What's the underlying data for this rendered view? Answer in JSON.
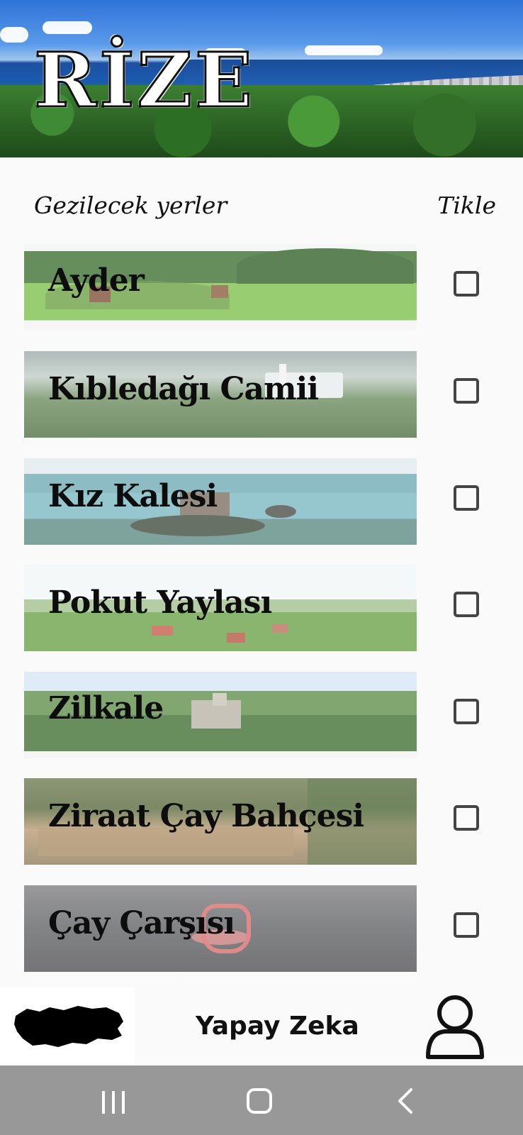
{
  "banner": {
    "logo_text": "RİZE"
  },
  "header": {
    "places_label": "Gezilecek yerler",
    "check_label": "Tikle"
  },
  "places": [
    {
      "name": "Ayder",
      "checked": false
    },
    {
      "name": "Kıbledağı Camii",
      "checked": false
    },
    {
      "name": "Kız Kalesi",
      "checked": false
    },
    {
      "name": "Pokut Yaylası",
      "checked": false
    },
    {
      "name": "Zilkale",
      "checked": false
    },
    {
      "name": "Ziraat Çay Bahçesi",
      "checked": false
    },
    {
      "name": "Çay Çarşısı",
      "checked": false
    }
  ],
  "bottom": {
    "ai_label": "Yapay Zeka",
    "map_icon": "turkey-map-icon",
    "profile_icon": "user-icon"
  },
  "nav": {
    "recents_icon": "recents-icon",
    "home_icon": "home-icon",
    "back_icon": "back-icon"
  }
}
